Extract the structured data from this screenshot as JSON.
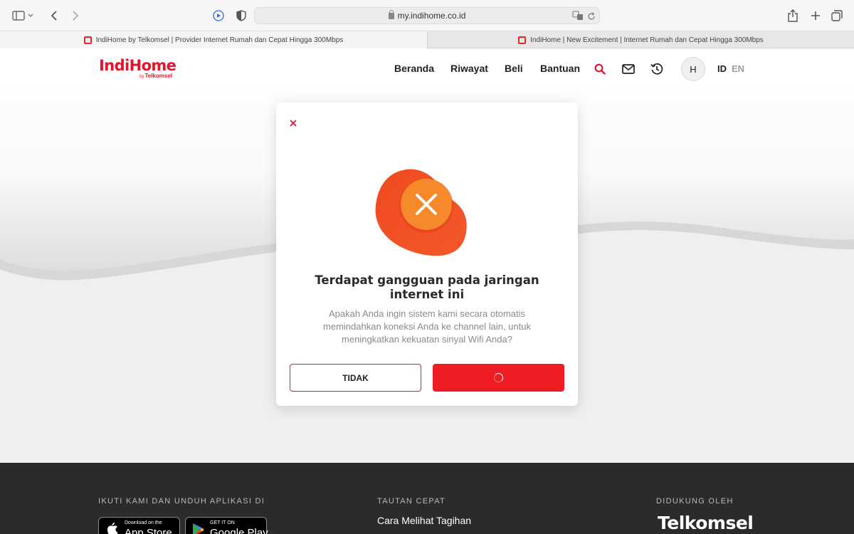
{
  "browser": {
    "url": "my.indihome.co.id",
    "tabs": [
      {
        "title": "IndiHome by Telkomsel | Provider Internet Rumah dan Cepat Hingga 300Mbps",
        "active": true
      },
      {
        "title": "IndiHome | New Excitement | Internet Rumah dan Cepat Hingga 300Mbps",
        "active": false
      }
    ]
  },
  "navbar": {
    "logo_text": "IndiHome",
    "logo_sub_prefix": "by",
    "logo_sub": "Telkomsel",
    "items": [
      "Beranda",
      "Riwayat",
      "Beli",
      "Bantuan"
    ],
    "avatar_initial": "H",
    "lang_active": "ID",
    "lang_inactive": "EN"
  },
  "modal": {
    "title": "Terdapat gangguan pada jaringan internet ini",
    "description": "Apakah Anda ingin sistem kami secara otomatis memindahkan koneksi Anda ke channel lain, untuk meningkatkan kekuatan sinyal Wifi Anda?",
    "cancel_label": "TIDAK"
  },
  "footer": {
    "follow_heading": "IKUTI KAMI DAN UNDUH APLIKASI DI",
    "app_store_small": "Download on the",
    "app_store_big": "App Store",
    "google_play_small": "GET IT ON",
    "google_play_big": "Google Play",
    "quick_links_heading": "TAUTAN CEPAT",
    "quick_link_1": "Cara Melihat Tagihan",
    "supported_heading": "DIDUKUNG OLEH",
    "supported_brand": "Telkomsel"
  },
  "colors": {
    "brand_red": "#ee1d24",
    "logo_red": "#e4142a",
    "illustration_orange": "#f68a2b",
    "footer_bg": "#2b2b2c"
  }
}
